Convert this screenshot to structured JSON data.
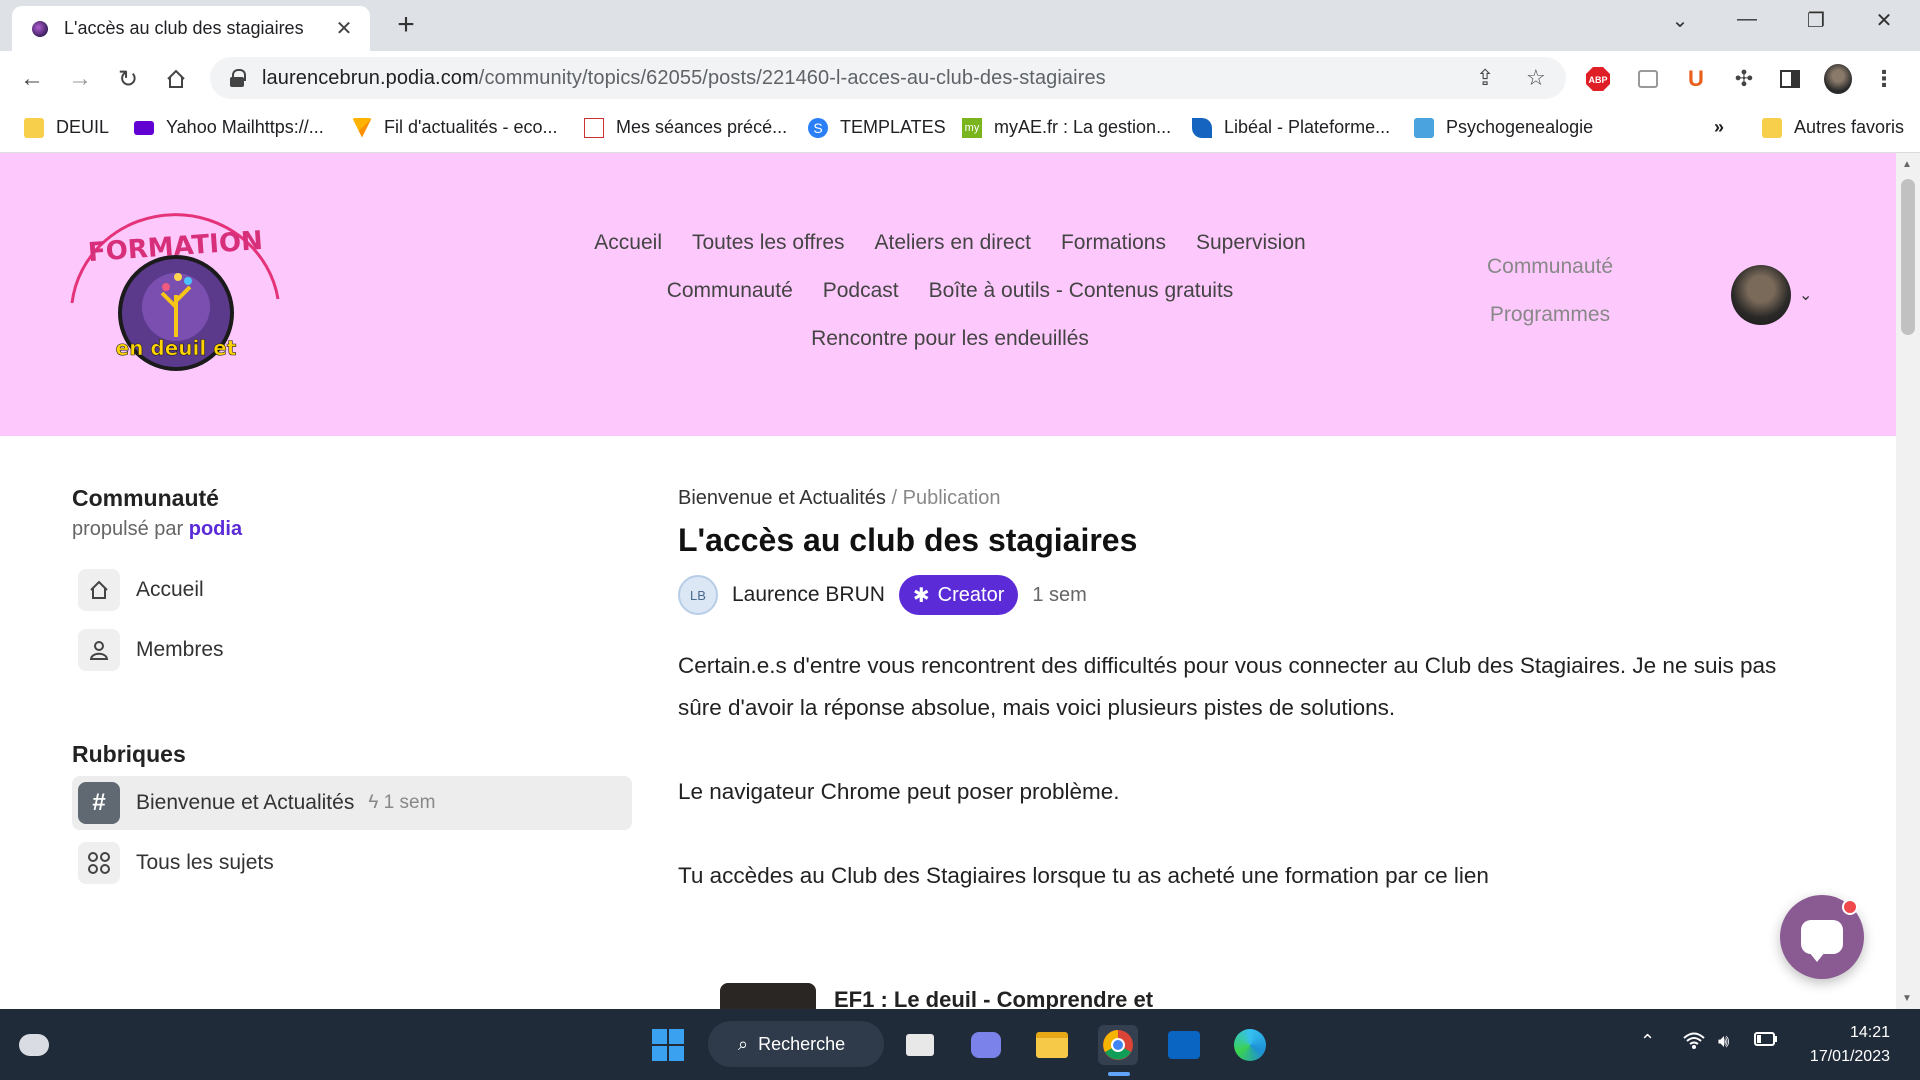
{
  "browser": {
    "tab_title": "L'accès au club des stagiaires",
    "url_domain": "laurencebrun.podia.com",
    "url_path": "/community/topics/62055/posts/221460-l-acces-au-club-des-stagiaires",
    "bookmarks": [
      "DEUIL",
      "Yahoo Mailhttps://...",
      "Fil d'actualités - eco...",
      "Mes séances précé...",
      "TEMPLATES",
      "myAE.fr : La gestion...",
      "Libéal - Plateforme...",
      "Psychogenealogie"
    ],
    "more_label": "»",
    "other_favorites": "Autres favoris",
    "extensions": {
      "abp": "ABP",
      "ublock": "U"
    }
  },
  "site": {
    "logo_text_top": "FORMATION",
    "logo_text_bottom": "en deuil et",
    "nav": {
      "row1": [
        "Accueil",
        "Toutes les offres",
        "Ateliers en direct",
        "Formations",
        "Supervision"
      ],
      "row2": [
        "Communauté",
        "Podcast",
        "Boîte à outils - Contenus gratuits"
      ],
      "row3": [
        "Rencontre pour les endeuillés"
      ]
    },
    "side_nav": [
      "Communauté",
      "Programmes"
    ]
  },
  "sidebar": {
    "title": "Communauté",
    "powered_prefix": "propulsé par",
    "powered_brand": "podia",
    "items": [
      {
        "label": "Accueil",
        "icon": "home-icon"
      },
      {
        "label": "Membres",
        "icon": "user-icon"
      }
    ],
    "rubriques_title": "Rubriques",
    "rubriques": [
      {
        "label": "Bienvenue et Actualités",
        "meta": "1 sem",
        "icon": "hash-icon"
      },
      {
        "label": "Tous les sujets",
        "icon": "grid-icon"
      }
    ]
  },
  "post": {
    "breadcrumb_topic": "Bienvenue et Actualités",
    "breadcrumb_sep": "/",
    "breadcrumb_current": "Publication",
    "title": "L'accès au club des stagiaires",
    "author_initials": "LB",
    "author": "Laurence BRUN",
    "badge": "Creator",
    "time_ago": "1 sem",
    "paragraphs": [
      "Certain.e.s d'entre vous rencontrent des difficultés pour vous connecter au Club des Stagiaires. Je ne suis pas sûre d'avoir la réponse absolue, mais voici plusieurs pistes de solutions.",
      "Le navigateur Chrome peut poser problème.",
      "Tu accèdes au Club des Stagiaires lorsque tu as acheté une formation par ce lien"
    ],
    "card_title": "EF1 : Le deuil - Comprendre et"
  },
  "taskbar": {
    "search_label": "Recherche",
    "time": "14:21",
    "date": "17/01/2023"
  },
  "colors": {
    "header_bg": "#fdc9fc",
    "podia_purple": "#5b2bd8",
    "taskbar_bg": "#202b3a"
  }
}
